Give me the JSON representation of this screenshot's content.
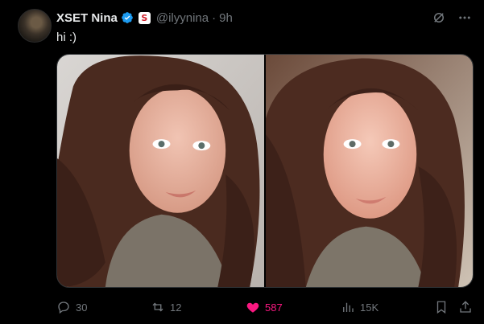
{
  "author": {
    "display_name": "XSET Nina",
    "handle": "@ilyynina",
    "separator": "·",
    "timestamp": "9h",
    "verified_icon": "verified-badge-icon",
    "affiliate_badge_text": "S"
  },
  "tweet": {
    "text": "hi :)"
  },
  "top_icons": [
    "grok-icon",
    "more-icon"
  ],
  "media": {
    "count": 2,
    "photos": [
      "selfie-photo-1",
      "selfie-photo-2"
    ]
  },
  "actions": {
    "replies": "30",
    "reposts": "12",
    "likes": "587",
    "views": "15K",
    "liked": true
  },
  "colors": {
    "background": "#000000",
    "text": "#e7e9ea",
    "muted": "#71767b",
    "like": "#f91880",
    "verified": "#1d9bf0"
  }
}
